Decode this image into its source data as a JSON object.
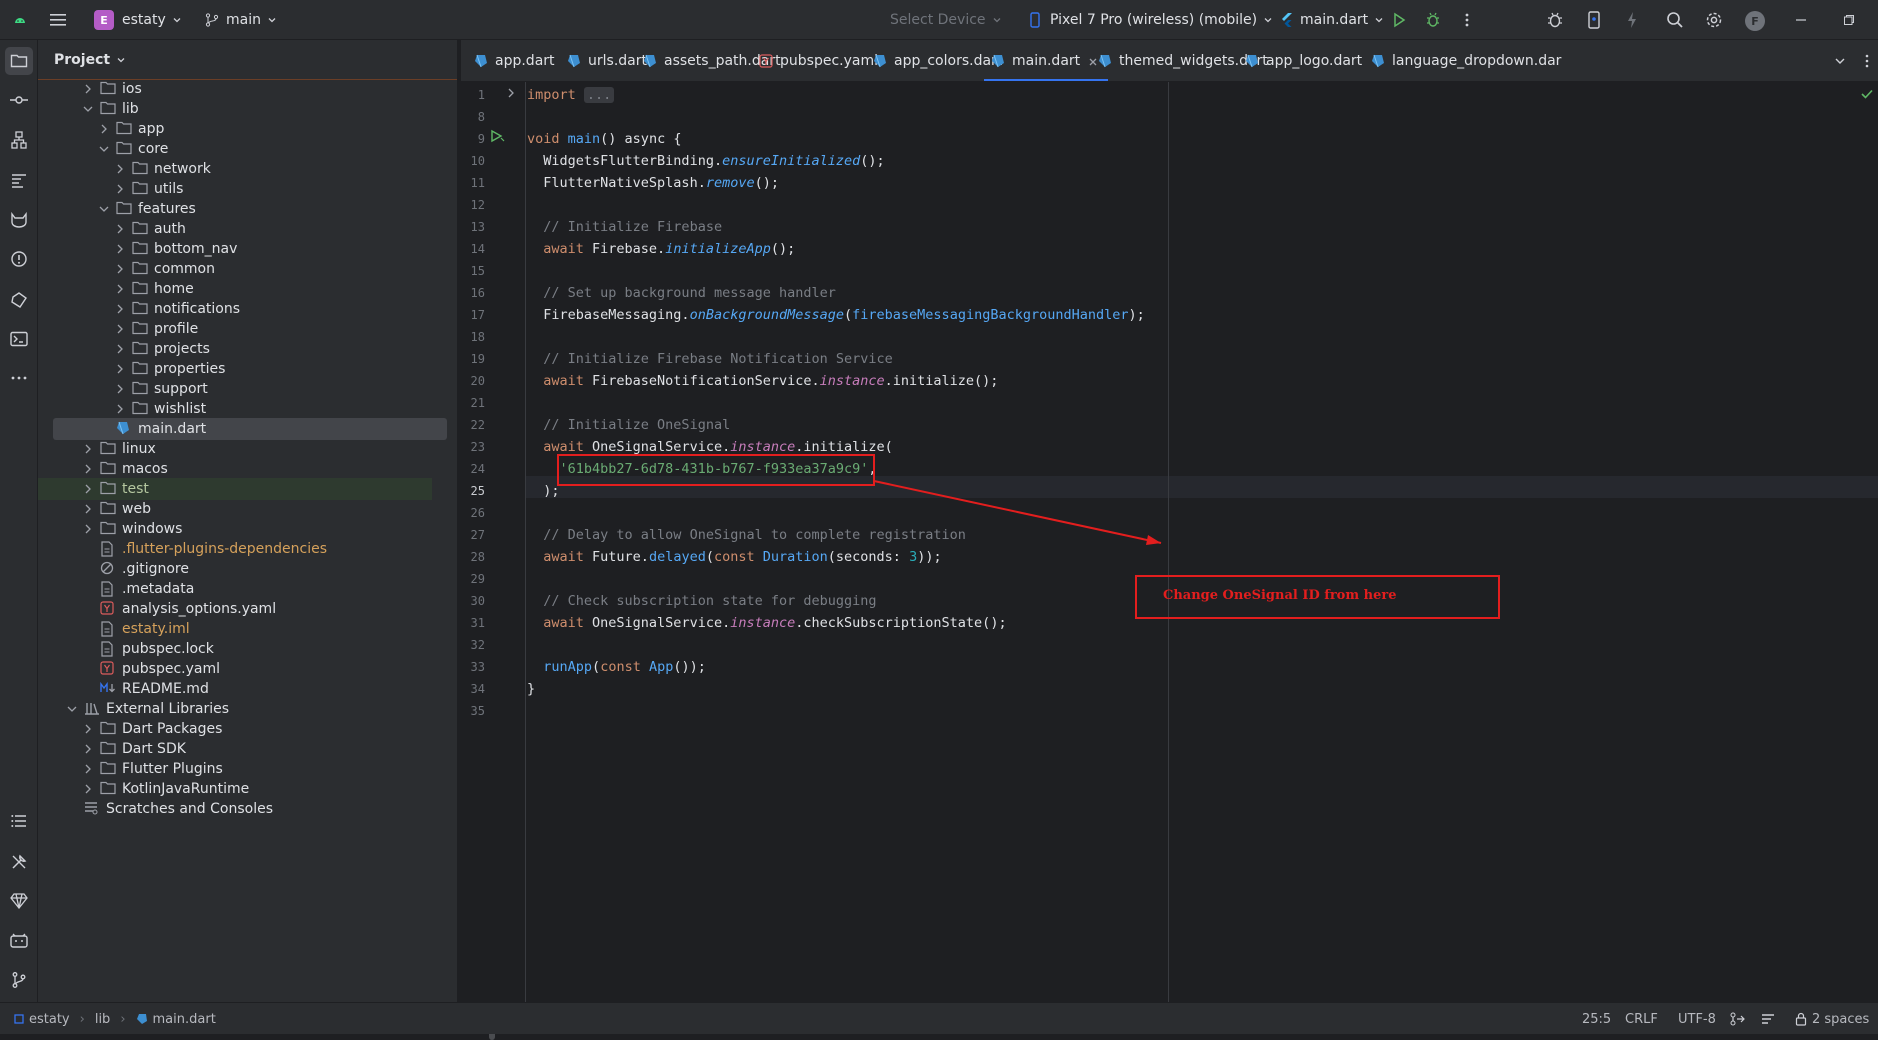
{
  "titlebar": {
    "project_badge": "E",
    "project_name": "estaty",
    "branch": "main",
    "device_selector": "Select Device",
    "device": "Pixel 7 Pro (wireless) (mobile)",
    "run_config": "main.dart",
    "avatar": "F"
  },
  "project_panel": {
    "title": "Project",
    "items": [
      {
        "label": "ios",
        "type": "folder"
      },
      {
        "label": "lib",
        "type": "folder"
      },
      {
        "label": "app",
        "type": "folder"
      },
      {
        "label": "core",
        "type": "folder"
      },
      {
        "label": "network",
        "type": "folder"
      },
      {
        "label": "utils",
        "type": "folder"
      },
      {
        "label": "features",
        "type": "folder"
      },
      {
        "label": "auth",
        "type": "folder"
      },
      {
        "label": "bottom_nav",
        "type": "folder"
      },
      {
        "label": "common",
        "type": "folder"
      },
      {
        "label": "home",
        "type": "folder"
      },
      {
        "label": "notifications",
        "type": "folder"
      },
      {
        "label": "profile",
        "type": "folder"
      },
      {
        "label": "projects",
        "type": "folder"
      },
      {
        "label": "properties",
        "type": "folder"
      },
      {
        "label": "support",
        "type": "folder"
      },
      {
        "label": "wishlist",
        "type": "folder"
      },
      {
        "label": "main.dart",
        "type": "dart"
      },
      {
        "label": "linux",
        "type": "folder"
      },
      {
        "label": "macos",
        "type": "folder"
      },
      {
        "label": "test",
        "type": "folder"
      },
      {
        "label": "web",
        "type": "folder"
      },
      {
        "label": "windows",
        "type": "folder"
      },
      {
        "label": ".flutter-plugins-dependencies",
        "type": "file"
      },
      {
        "label": ".gitignore",
        "type": "ignore"
      },
      {
        "label": ".metadata",
        "type": "file"
      },
      {
        "label": "analysis_options.yaml",
        "type": "yaml"
      },
      {
        "label": "estaty.iml",
        "type": "file"
      },
      {
        "label": "pubspec.lock",
        "type": "file"
      },
      {
        "label": "pubspec.yaml",
        "type": "yaml"
      },
      {
        "label": "README.md",
        "type": "md"
      },
      {
        "label": "External Libraries",
        "type": "lib"
      },
      {
        "label": "Dart Packages",
        "type": "folder"
      },
      {
        "label": "Dart SDK",
        "type": "folder"
      },
      {
        "label": "Flutter Plugins",
        "type": "folder"
      },
      {
        "label": "KotlinJavaRuntime",
        "type": "folder"
      },
      {
        "label": "Scratches and Consoles",
        "type": "scratch"
      }
    ]
  },
  "tabs": [
    {
      "label": "app.dart",
      "type": "dart"
    },
    {
      "label": "urls.dart",
      "type": "dart"
    },
    {
      "label": "assets_path.dart",
      "type": "dart"
    },
    {
      "label": "pubspec.yaml",
      "type": "yaml"
    },
    {
      "label": "app_colors.dart",
      "type": "dart"
    },
    {
      "label": "main.dart",
      "type": "dart",
      "active": true
    },
    {
      "label": "themed_widgets.dart",
      "type": "dart"
    },
    {
      "label": "app_logo.dart",
      "type": "dart"
    },
    {
      "label": "language_dropdown.dar",
      "type": "dart"
    }
  ],
  "editor": {
    "line_numbers": [
      "1",
      "8",
      "9",
      "10",
      "11",
      "12",
      "13",
      "14",
      "15",
      "16",
      "17",
      "18",
      "19",
      "20",
      "21",
      "22",
      "23",
      "24",
      "25",
      "26",
      "27",
      "28",
      "29",
      "30",
      "31",
      "32",
      "33",
      "34",
      "35"
    ],
    "code": {
      "import_kw": "import",
      "import_fold": "...",
      "l9_void": "void",
      "l9_main": "main",
      "l9_rest": "() async {",
      "l10_a": "WidgetsFlutterBinding.",
      "l10_b": "ensureInitialized",
      "l10_c": "();",
      "l11_a": "FlutterNativeSplash.",
      "l11_b": "remove",
      "l11_c": "();",
      "l13": "// Initialize Firebase",
      "l14_a": "await",
      "l14_b": " Firebase.",
      "l14_c": "initializeApp",
      "l14_d": "();",
      "l16": "// Set up background message handler",
      "l17_a": "FirebaseMessaging.",
      "l17_b": "onBackgroundMessage",
      "l17_c": "(",
      "l17_d": "firebaseMessagingBackgroundHandler",
      "l17_e": ");",
      "l19": "// Initialize Firebase Notification Service",
      "l20_a": "await",
      "l20_b": " FirebaseNotificationService.",
      "l20_c": "instance",
      "l20_d": ".initialize();",
      "l22": "// Initialize OneSignal",
      "l23_a": "await",
      "l23_b": " OneSignalService.",
      "l23_c": "instance",
      "l23_d": ".initialize(",
      "l24_a": "'61b4bb27-6d78-431b-b767-f933ea37a9c9'",
      "l24_b": ",",
      "l25": ");",
      "l27": "// Delay to allow OneSignal to complete registration",
      "l28_a": "await",
      "l28_b": " Future.",
      "l28_c": "delayed",
      "l28_d": "(",
      "l28_e": "const",
      "l28_f": " Duration",
      "l28_g": "(seconds: ",
      "l28_h": "3",
      "l28_i": "));",
      "l30": "// Check subscription state for debugging",
      "l31_a": "await",
      "l31_b": " OneSignalService.",
      "l31_c": "instance",
      "l31_d": ".checkSubscriptionState();",
      "l33_a": "runApp",
      "l33_b": "(",
      "l33_c": "const",
      "l33_d": " App",
      "l33_e": "());",
      "l34": "}"
    },
    "annotation": "Change OneSignal ID from here"
  },
  "statusbar": {
    "crumb_project": "estaty",
    "crumb_folder": "lib",
    "crumb_file": "main.dart",
    "position": "25:5",
    "line_sep": "CRLF",
    "encoding": "UTF-8",
    "indent": "2 spaces"
  },
  "colors": {
    "accent": "#3574f0",
    "annotation": "#e31e1e",
    "keyword": "#cf8e6d",
    "string": "#6aab73",
    "comment": "#7a7e85"
  }
}
